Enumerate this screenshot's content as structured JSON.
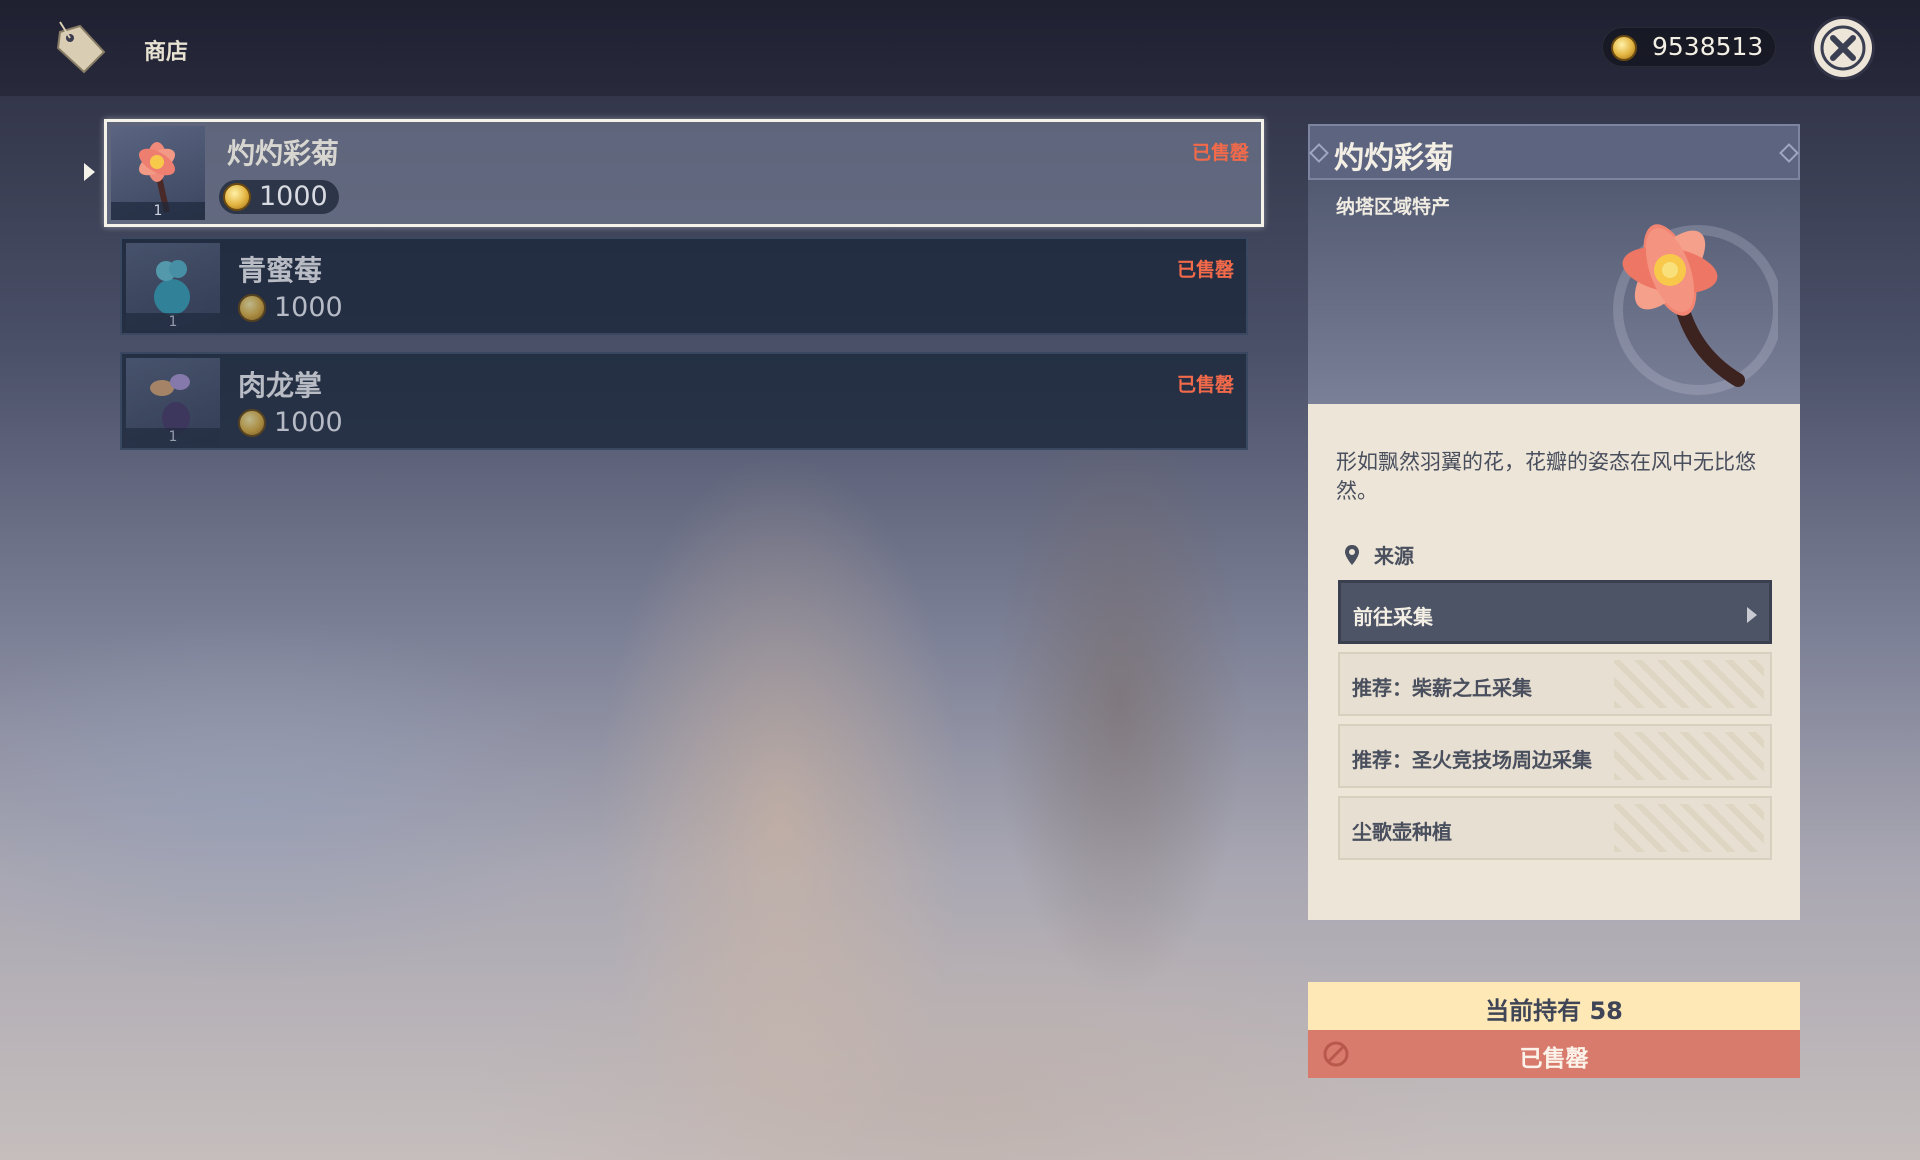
{
  "header": {
    "title": "商店",
    "shop_icon": "price-tag-icon",
    "currency_amount": "9538513",
    "currency_icon": "mora-coin-icon",
    "close_icon": "close-icon"
  },
  "items": [
    {
      "name": "灼灼彩菊",
      "price": "1000",
      "qty": "1",
      "status": "已售罄",
      "selected": true,
      "icon": "sumeru-rose-flower-icon"
    },
    {
      "name": "青蜜莓",
      "price": "1000",
      "qty": "1",
      "status": "已售罄",
      "selected": false,
      "icon": "berry-icon"
    },
    {
      "name": "肉龙掌",
      "price": "1000",
      "qty": "1",
      "status": "已售罄",
      "selected": false,
      "icon": "plant-icon"
    }
  ],
  "detail": {
    "name": "灼灼彩菊",
    "region": "纳塔区域特产",
    "description": "形如飘然羽翼的花，花瓣的姿态在风中无比悠然。",
    "source_label": "来源",
    "sources": [
      {
        "label": "前往采集",
        "active": true
      },
      {
        "label": "推荐：柴薪之丘采集",
        "active": false
      },
      {
        "label": "推荐：圣火竞技场周边采集",
        "active": false
      },
      {
        "label": "尘歌壶种植",
        "active": false
      }
    ]
  },
  "footer": {
    "holding": "当前持有 58",
    "sold_out": "已售罄"
  },
  "colors": {
    "sold_out_red": "#f36a4a",
    "holding_bg": "#fde8b6",
    "sold_bar_bg": "#d87a6c",
    "detail_bg": "#ece5d8"
  }
}
